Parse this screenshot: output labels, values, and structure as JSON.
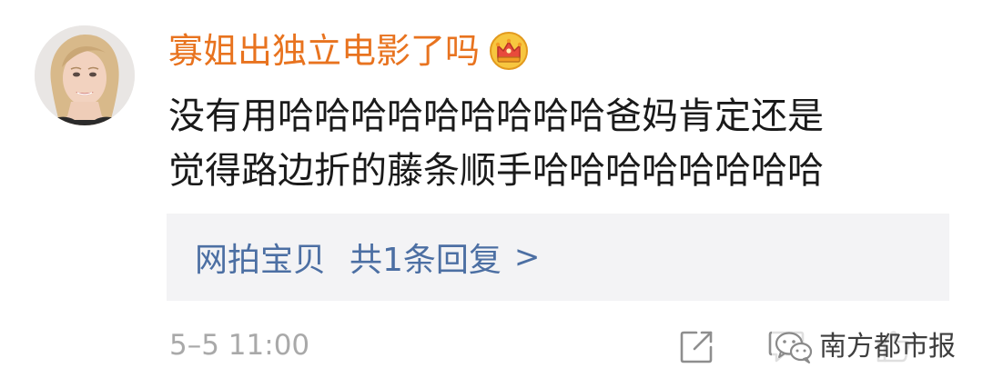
{
  "comment": {
    "username": "寡姐出独立电影了吗",
    "badge_icon": "crown-icon",
    "text_lines": [
      "没有用哈哈哈哈哈哈哈哈哈爸妈肯定还是",
      "觉得路边折的藤条顺手哈哈哈哈哈哈哈哈"
    ],
    "reply_box": {
      "source_label": "网拍宝贝",
      "reply_count_label": "共1条回复",
      "arrow": ">"
    },
    "timestamp": "5–5 11:00",
    "actions": {
      "share_icon": "share-icon",
      "comment_icon": "comment-icon",
      "like_icon": "like-icon"
    }
  },
  "watermark": {
    "logo_icon": "wechat-icon",
    "text": "南方都市报"
  },
  "colors": {
    "username": "#e8731f",
    "reply_link": "#4c6fa3",
    "reply_bg": "#f3f3f5",
    "timestamp": "#a9a9a9"
  }
}
